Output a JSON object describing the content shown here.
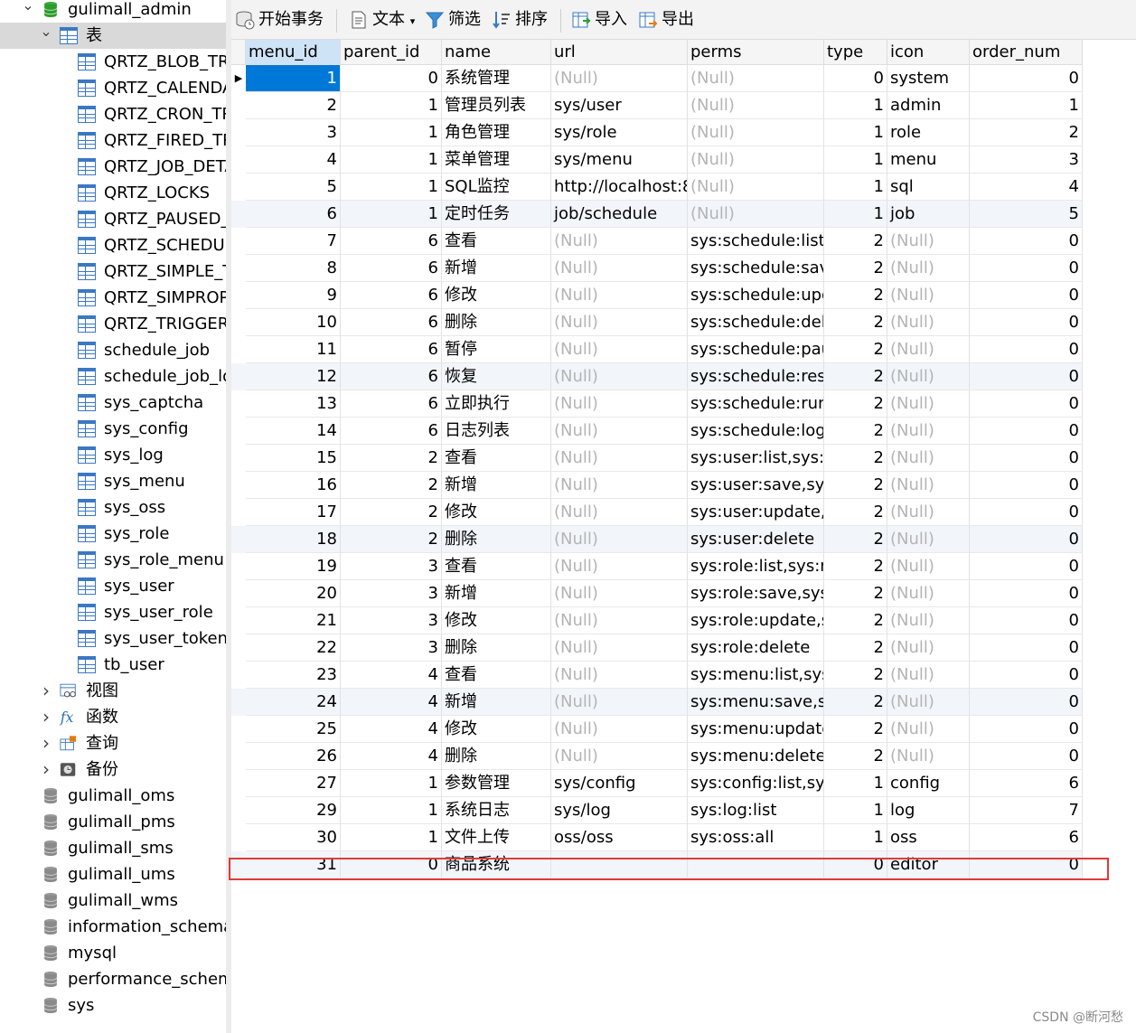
{
  "tree": {
    "db_open": "gulimall_admin",
    "tables_group": "表",
    "tables": [
      "QRTZ_BLOB_TRI",
      "QRTZ_CALENDA",
      "QRTZ_CRON_TR",
      "QRTZ_FIRED_TR",
      "QRTZ_JOB_DETA",
      "QRTZ_LOCKS",
      "QRTZ_PAUSED_",
      "QRTZ_SCHEDUL",
      "QRTZ_SIMPLE_T",
      "QRTZ_SIMPROP",
      "QRTZ_TRIGGERS",
      "schedule_job",
      "schedule_job_lo",
      "sys_captcha",
      "sys_config",
      "sys_log",
      "sys_menu",
      "sys_oss",
      "sys_role",
      "sys_role_menu",
      "sys_user",
      "sys_user_role",
      "sys_user_token",
      "tb_user"
    ],
    "groups": [
      {
        "label": "视图",
        "icon": "view-icon"
      },
      {
        "label": "函数",
        "icon": "function-icon"
      },
      {
        "label": "查询",
        "icon": "query-icon"
      },
      {
        "label": "备份",
        "icon": "backup-icon"
      }
    ],
    "databases": [
      "gulimall_oms",
      "gulimall_pms",
      "gulimall_sms",
      "gulimall_ums",
      "gulimall_wms",
      "information_schema",
      "mysql",
      "performance_schema",
      "sys"
    ]
  },
  "toolbar": {
    "begin_transaction": "开始事务",
    "text": "文本",
    "filter": "筛选",
    "sort": "排序",
    "import": "导入",
    "export": "导出"
  },
  "grid": {
    "columns": [
      "menu_id",
      "parent_id",
      "name",
      "url",
      "perms",
      "type",
      "icon",
      "order_num"
    ],
    "null_text": "(Null)",
    "rows": [
      [
        "1",
        "0",
        "系统管理",
        null,
        null,
        "0",
        "system",
        "0"
      ],
      [
        "2",
        "1",
        "管理员列表",
        "sys/user",
        null,
        "1",
        "admin",
        "1"
      ],
      [
        "3",
        "1",
        "角色管理",
        "sys/role",
        null,
        "1",
        "role",
        "2"
      ],
      [
        "4",
        "1",
        "菜单管理",
        "sys/menu",
        null,
        "1",
        "menu",
        "3"
      ],
      [
        "5",
        "1",
        "SQL监控",
        "http://localhost:8",
        null,
        "1",
        "sql",
        "4"
      ],
      [
        "6",
        "1",
        "定时任务",
        "job/schedule",
        null,
        "1",
        "job",
        "5"
      ],
      [
        "7",
        "6",
        "查看",
        null,
        "sys:schedule:list,s",
        "2",
        null,
        "0"
      ],
      [
        "8",
        "6",
        "新增",
        null,
        "sys:schedule:save",
        "2",
        null,
        "0"
      ],
      [
        "9",
        "6",
        "修改",
        null,
        "sys:schedule:upda",
        "2",
        null,
        "0"
      ],
      [
        "10",
        "6",
        "删除",
        null,
        "sys:schedule:dele",
        "2",
        null,
        "0"
      ],
      [
        "11",
        "6",
        "暂停",
        null,
        "sys:schedule:paus",
        "2",
        null,
        "0"
      ],
      [
        "12",
        "6",
        "恢复",
        null,
        "sys:schedule:resu",
        "2",
        null,
        "0"
      ],
      [
        "13",
        "6",
        "立即执行",
        null,
        "sys:schedule:run",
        "2",
        null,
        "0"
      ],
      [
        "14",
        "6",
        "日志列表",
        null,
        "sys:schedule:log",
        "2",
        null,
        "0"
      ],
      [
        "15",
        "2",
        "查看",
        null,
        "sys:user:list,sys:us",
        "2",
        null,
        "0"
      ],
      [
        "16",
        "2",
        "新增",
        null,
        "sys:user:save,sys:r",
        "2",
        null,
        "0"
      ],
      [
        "17",
        "2",
        "修改",
        null,
        "sys:user:update,sy",
        "2",
        null,
        "0"
      ],
      [
        "18",
        "2",
        "删除",
        null,
        "sys:user:delete",
        "2",
        null,
        "0"
      ],
      [
        "19",
        "3",
        "查看",
        null,
        "sys:role:list,sys:rol",
        "2",
        null,
        "0"
      ],
      [
        "20",
        "3",
        "新增",
        null,
        "sys:role:save,sys:n",
        "2",
        null,
        "0"
      ],
      [
        "21",
        "3",
        "修改",
        null,
        "sys:role:update,sy",
        "2",
        null,
        "0"
      ],
      [
        "22",
        "3",
        "删除",
        null,
        "sys:role:delete",
        "2",
        null,
        "0"
      ],
      [
        "23",
        "4",
        "查看",
        null,
        "sys:menu:list,sys:r",
        "2",
        null,
        "0"
      ],
      [
        "24",
        "4",
        "新增",
        null,
        "sys:menu:save,sys",
        "2",
        null,
        "0"
      ],
      [
        "25",
        "4",
        "修改",
        null,
        "sys:menu:update,",
        "2",
        null,
        "0"
      ],
      [
        "26",
        "4",
        "删除",
        null,
        "sys:menu:delete",
        "2",
        null,
        "0"
      ],
      [
        "27",
        "1",
        "参数管理",
        "sys/config",
        "sys:config:list,sys:",
        "1",
        "config",
        "6"
      ],
      [
        "29",
        "1",
        "系统日志",
        "sys/log",
        "sys:log:list",
        "1",
        "log",
        "7"
      ],
      [
        "30",
        "1",
        "文件上传",
        "oss/oss",
        "sys:oss:all",
        "1",
        "oss",
        "6"
      ],
      [
        "31",
        "0",
        "商品系统",
        "",
        "",
        "0",
        "editor",
        "0"
      ]
    ]
  },
  "colors": {
    "selection": "#0078d7",
    "null_text": "#b4b4b4",
    "highlight_border": "#e03a3a",
    "table_icon": "#3a78c4"
  },
  "watermark": "CSDN @断河愁"
}
